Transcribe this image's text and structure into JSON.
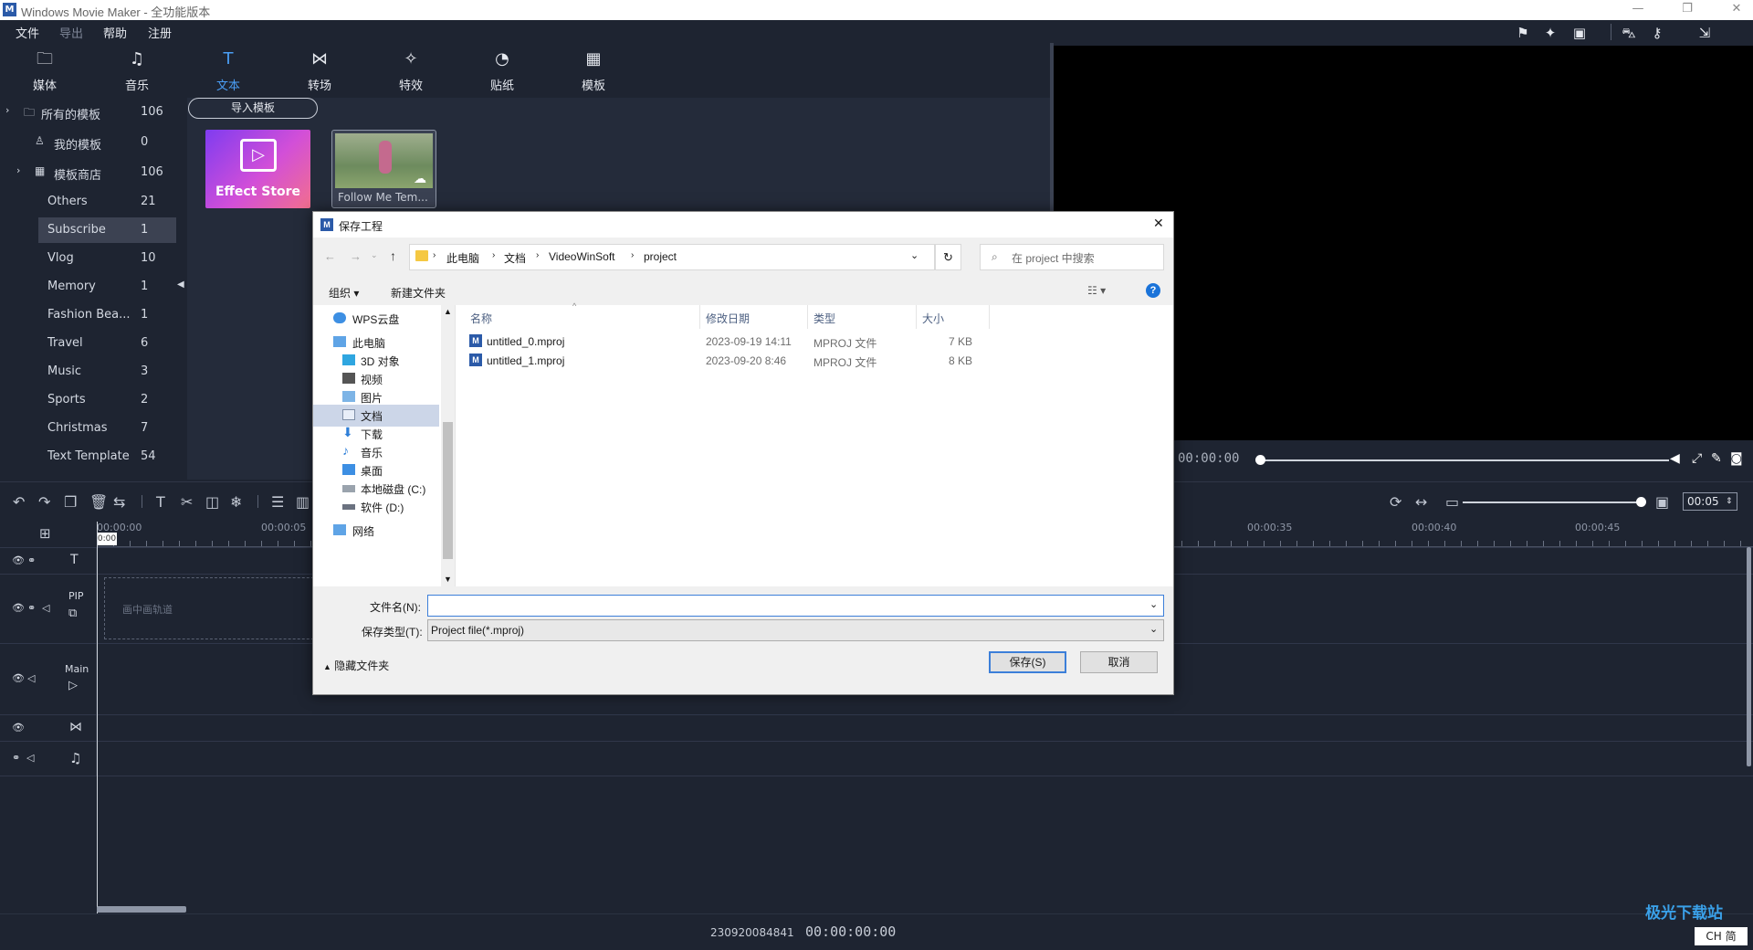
{
  "window": {
    "title": "Windows Movie Maker - 全功能版本",
    "app_icon": "M"
  },
  "menu": {
    "file": "文件",
    "export": "导出",
    "help": "帮助",
    "register": "注册"
  },
  "tabs": [
    {
      "label": "媒体",
      "icon": "media-icon"
    },
    {
      "label": "音乐",
      "icon": "music-icon"
    },
    {
      "label": "文本",
      "icon": "text-icon"
    },
    {
      "label": "转场",
      "icon": "transition-icon"
    },
    {
      "label": "特效",
      "icon": "effects-icon"
    },
    {
      "label": "贴纸",
      "icon": "sticker-icon"
    },
    {
      "label": "模板",
      "icon": "template-icon"
    }
  ],
  "sidebar": {
    "items": [
      {
        "label": "所有的模板",
        "count": "106"
      },
      {
        "label": "我的模板",
        "count": "0"
      },
      {
        "label": "模板商店",
        "count": "106"
      },
      {
        "label": "Others",
        "count": "21"
      },
      {
        "label": "Subscribe",
        "count": "1"
      },
      {
        "label": "Vlog",
        "count": "10"
      },
      {
        "label": "Memory",
        "count": "1"
      },
      {
        "label": "Fashion Bea...",
        "count": "1"
      },
      {
        "label": "Travel",
        "count": "6"
      },
      {
        "label": "Music",
        "count": "3"
      },
      {
        "label": "Sports",
        "count": "2"
      },
      {
        "label": "Christmas",
        "count": "7"
      },
      {
        "label": "Text Template",
        "count": "54"
      }
    ]
  },
  "content": {
    "import_button": "导入模板",
    "cards": [
      {
        "label": "Effect Store"
      },
      {
        "label": "Follow Me Tem..."
      }
    ]
  },
  "player": {
    "time": "00:00:00",
    "zoom_value": "00:05"
  },
  "timeline": {
    "ruler_labels": [
      "00:00:00",
      "00:00:05",
      "00:00:35",
      "00:00:40",
      "00:00:45"
    ],
    "playhead": "0:00",
    "tracks": {
      "text": "T",
      "pip": "PIP",
      "pip_placeholder": "画中画轨道",
      "main": "Main"
    }
  },
  "status": {
    "id": "230920084841",
    "time": "00:00:00:00",
    "watermark": "极光下载站",
    "ime": "CH 简"
  },
  "dialog": {
    "title": "保存工程",
    "breadcrumb": [
      "此电脑",
      "文档",
      "VideoWinSoft",
      "project"
    ],
    "search_placeholder": "在 project 中搜索",
    "organize": "组织",
    "new_folder": "新建文件夹",
    "nav": [
      {
        "label": "WPS云盘"
      },
      {
        "label": "此电脑"
      },
      {
        "label": "3D 对象"
      },
      {
        "label": "视频"
      },
      {
        "label": "图片"
      },
      {
        "label": "文档"
      },
      {
        "label": "下载"
      },
      {
        "label": "音乐"
      },
      {
        "label": "桌面"
      },
      {
        "label": "本地磁盘 (C:)"
      },
      {
        "label": "软件 (D:)"
      },
      {
        "label": "网络"
      }
    ],
    "columns": {
      "name": "名称",
      "date": "修改日期",
      "type": "类型",
      "size": "大小"
    },
    "files": [
      {
        "name": "untitled_0.mproj",
        "date": "2023-09-19 14:11",
        "type": "MPROJ 文件",
        "size": "7 KB"
      },
      {
        "name": "untitled_1.mproj",
        "date": "2023-09-20 8:46",
        "type": "MPROJ 文件",
        "size": "8 KB"
      }
    ],
    "filename_label": "文件名(N):",
    "filename_value": "",
    "filetype_label": "保存类型(T):",
    "filetype_value": "Project file(*.mproj)",
    "hide_folders": "隐藏文件夹",
    "save": "保存(S)",
    "cancel": "取消"
  }
}
